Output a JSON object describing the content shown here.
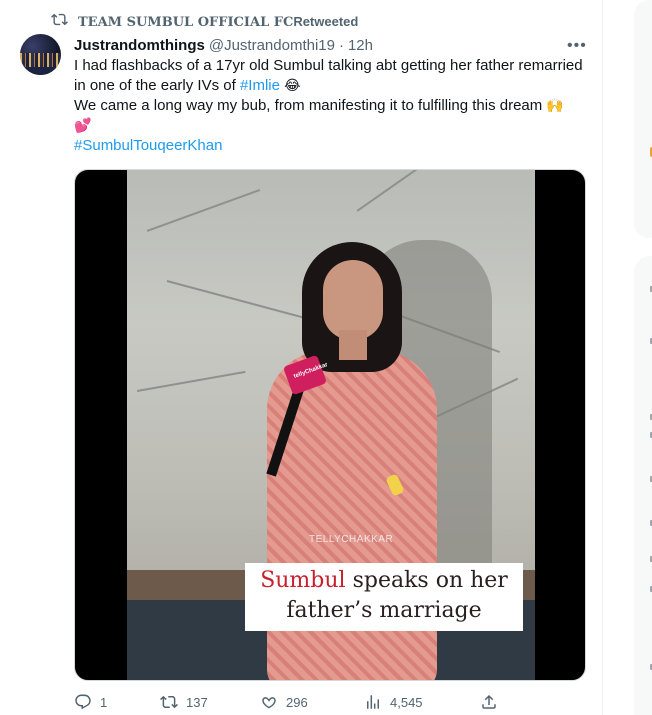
{
  "retweet": {
    "user": "TEAM SUMBUL OFFICIAL FC",
    "label": "Retweeted"
  },
  "tweet": {
    "display_name": "Justrandomthings",
    "handle": "@Justrandomthi19",
    "separator": "·",
    "time": "12h",
    "line1_pre": "I had flashbacks of a 17yr old Sumbul talking abt getting her father remarried in one of the early IVs of ",
    "line1_tag": "#Imlie",
    "line1_emoji": "😂",
    "line2": "We came a long way my bub, from manifesting it to fulfilling this dream ",
    "line2_emoji": "🙌",
    "line3_emoji": "💕",
    "hashtag": "#SumbulTouqeerKhan"
  },
  "media": {
    "mic_brand": "tellyChakkar",
    "watermark": "TELLYCHAKKAR",
    "caption_red": "Sumbul",
    "caption_rest": " speaks on her",
    "caption_line2": "father’s marriage"
  },
  "actions": {
    "replies": "1",
    "retweets": "137",
    "likes": "296",
    "views": "4,545"
  },
  "colors": {
    "accent": "#1d9bf0",
    "muted": "#536471",
    "text": "#0f1419"
  },
  "icons": [
    "retweet-icon",
    "more-icon",
    "reply-icon",
    "like-icon",
    "views-icon",
    "share-icon"
  ]
}
